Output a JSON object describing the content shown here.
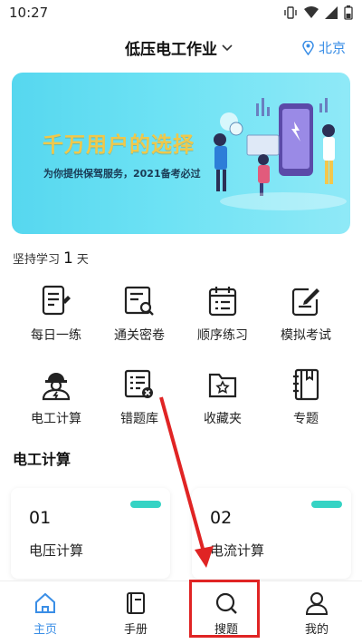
{
  "status": {
    "time": "10:27"
  },
  "header": {
    "title": "低压电工作业",
    "location": "北京"
  },
  "banner": {
    "headline": "千万用户的选择",
    "subtitle": "为你提供保驾服务，2021备考必过"
  },
  "streak": {
    "prefix": "坚持学习",
    "days": "1",
    "suffix": "天"
  },
  "grid": {
    "items": [
      {
        "label": "每日一练",
        "icon": "daily-practice-icon"
      },
      {
        "label": "通关密卷",
        "icon": "exam-paper-icon"
      },
      {
        "label": "顺序练习",
        "icon": "calendar-list-icon"
      },
      {
        "label": "模拟考试",
        "icon": "edit-note-icon"
      },
      {
        "label": "电工计算",
        "icon": "electrician-icon"
      },
      {
        "label": "错题库",
        "icon": "wrong-questions-icon"
      },
      {
        "label": "收藏夹",
        "icon": "star-folder-icon"
      },
      {
        "label": "专题",
        "icon": "notebook-icon"
      }
    ]
  },
  "section": {
    "title": "电工计算"
  },
  "cards": [
    {
      "num": "01",
      "name": "电压计算"
    },
    {
      "num": "02",
      "name": "电流计算"
    }
  ],
  "tabs": [
    {
      "label": "主页",
      "icon": "home-icon"
    },
    {
      "label": "手册",
      "icon": "book-icon"
    },
    {
      "label": "搜题",
      "icon": "search-icon"
    },
    {
      "label": "我的",
      "icon": "user-icon"
    }
  ],
  "colors": {
    "accent": "#3a8ee6",
    "highlight": "#e02424",
    "pill": "#35d3c4"
  }
}
